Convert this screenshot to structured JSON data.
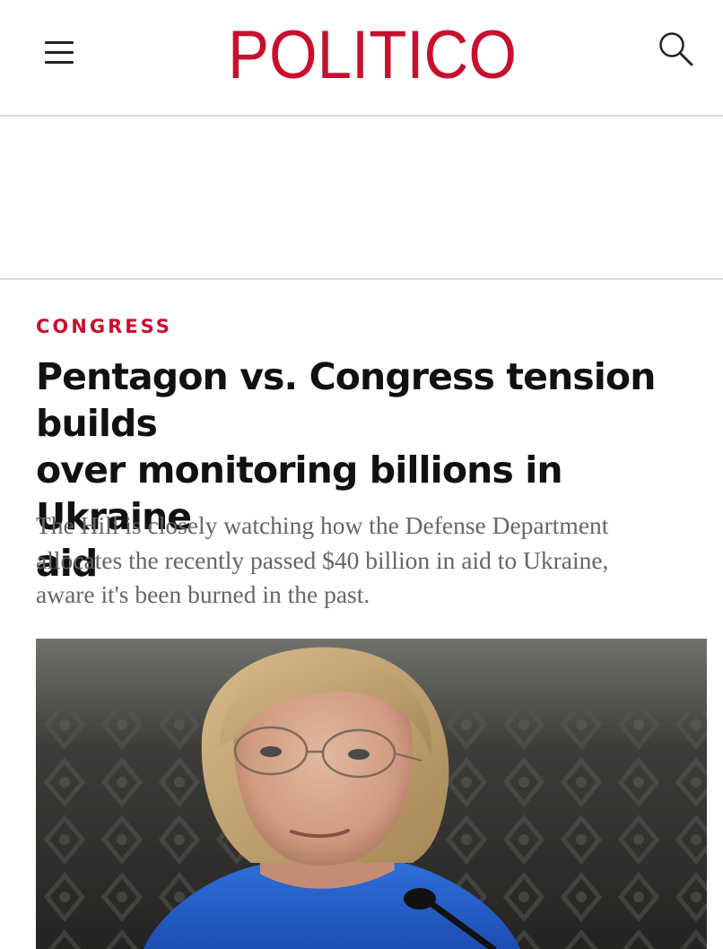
{
  "header": {
    "logo_text": "POLITICO",
    "brand_color": "#c8102e",
    "menu_icon": "hamburger-menu-icon",
    "search_icon": "search-icon"
  },
  "article": {
    "category": "CONGRESS",
    "headline_lines": [
      "Pentagon vs. Congress tension builds",
      "over monitoring billions in Ukraine",
      "aid"
    ],
    "dek_lines": [
      "The Hill is closely watching how the Defense Department",
      "allocates the recently passed $40 billion in aid to Ukraine,",
      "aware it's been burned in the past."
    ]
  }
}
